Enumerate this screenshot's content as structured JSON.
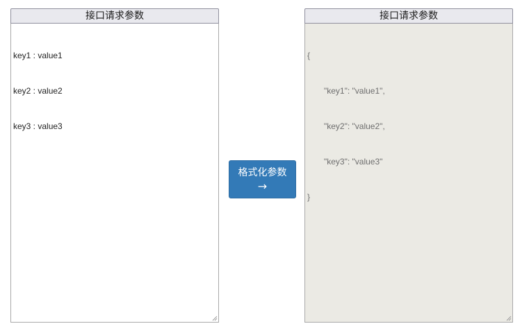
{
  "left_panel": {
    "header": "接口请求参数",
    "lines": [
      "key1 : value1",
      "key2 : value2",
      "key3 : value3"
    ]
  },
  "format_button": {
    "label": "格式化参数",
    "arrow": "→"
  },
  "right_panel": {
    "header": "接口请求参数",
    "lines": [
      "{",
      "\"key1\": \"value1\",",
      "\"key2\": \"value2\",",
      "\"key3\": \"value3\"",
      "}"
    ]
  },
  "colors": {
    "button_bg": "#337ab7",
    "output_bg": "#ebeae4"
  }
}
